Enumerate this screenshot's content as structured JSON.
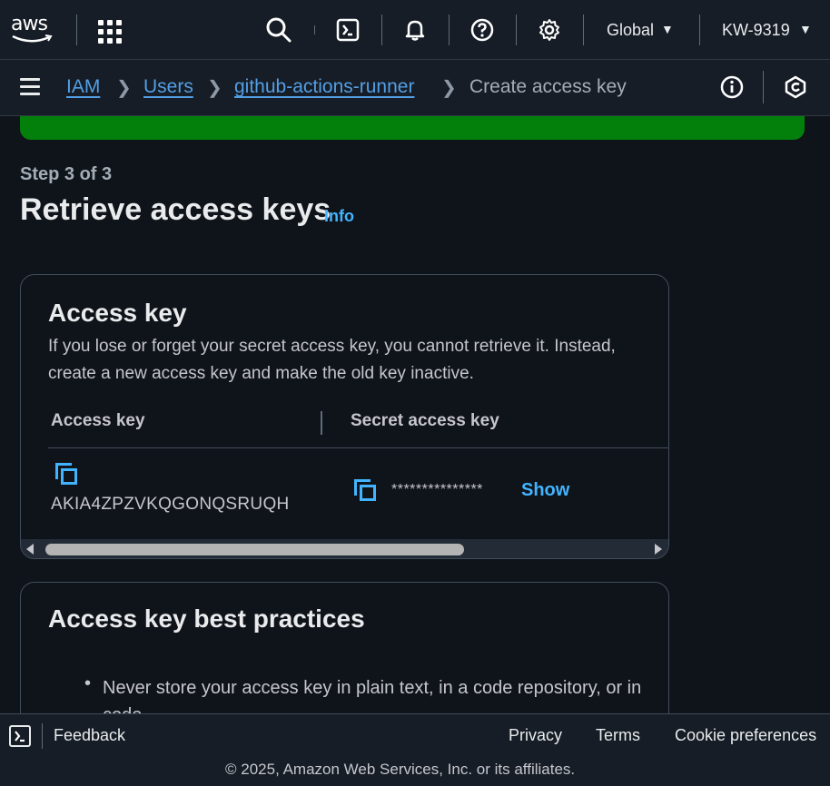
{
  "topbar": {
    "logo_text": "aws",
    "region": "Global",
    "account": "KW-9319"
  },
  "breadcrumb": {
    "items": [
      "IAM",
      "Users",
      "github-actions-runner"
    ],
    "current": "Create access key"
  },
  "page": {
    "step": "Step 3 of 3",
    "title": "Retrieve access keys",
    "info_link": "Info"
  },
  "access_key_card": {
    "heading": "Access key",
    "description": "If you lose or forget your secret access key, you cannot retrieve it. Instead, create a new access key and make the old key inactive.",
    "col_access_key": "Access key",
    "col_secret": "Secret access key",
    "access_key_value": "AKIA4ZPZVKQGONQSRUQH",
    "secret_masked": "***************",
    "show_label": "Show"
  },
  "best_practices": {
    "heading": "Access key best practices",
    "items": [
      "Never store your access key in plain text, in a code repository, or in code."
    ]
  },
  "footer": {
    "feedback": "Feedback",
    "privacy": "Privacy",
    "terms": "Terms",
    "cookies": "Cookie preferences",
    "copyright": "© 2025, Amazon Web Services, Inc. or its affiliates."
  },
  "colors": {
    "link": "#539fe5",
    "accent": "#42b4ff",
    "success": "#037f0c",
    "background": "#0f141a",
    "header": "#161d26"
  }
}
